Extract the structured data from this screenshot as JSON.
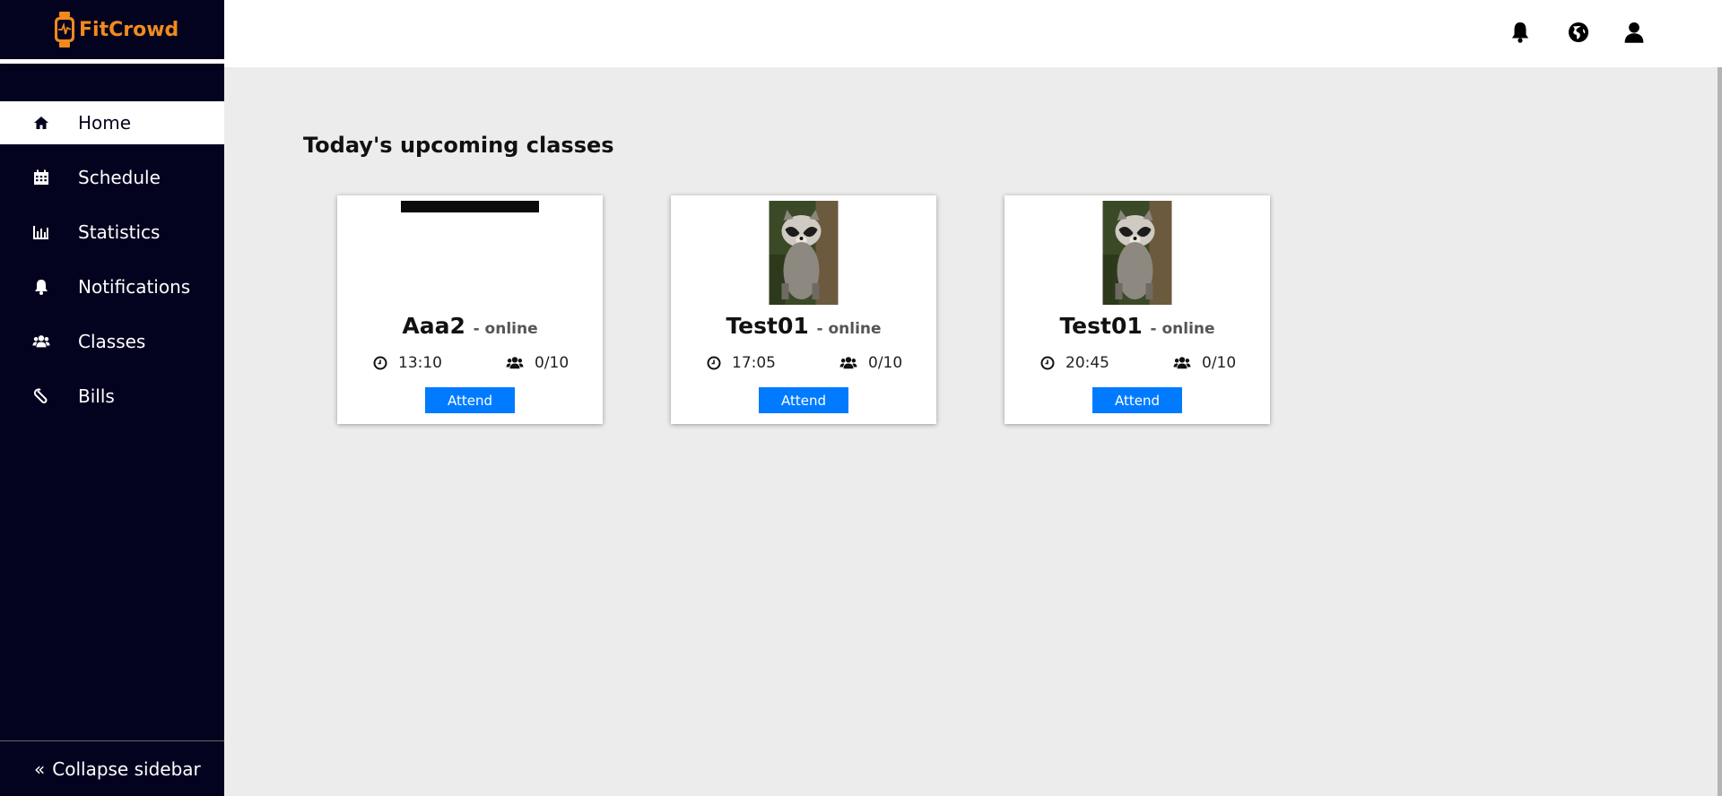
{
  "app": {
    "brand": "FitCrowd"
  },
  "sidebar": {
    "items": [
      {
        "label": "Home",
        "icon": "home-icon",
        "active": true
      },
      {
        "label": "Schedule",
        "icon": "calendar-icon"
      },
      {
        "label": "Statistics",
        "icon": "bar-chart-icon"
      },
      {
        "label": "Notifications",
        "icon": "bell-icon"
      },
      {
        "label": "Classes",
        "icon": "users-icon"
      },
      {
        "label": "Bills",
        "icon": "paperclip-icon"
      }
    ],
    "collapse_label": "Collapse sidebar"
  },
  "topbar": {
    "icons": [
      "bell-icon",
      "globe-icon",
      "user-icon"
    ]
  },
  "main": {
    "heading": "Today's upcoming classes",
    "classes": [
      {
        "name": "Aaa2",
        "mode": "- online",
        "time": "13:10",
        "capacity": "0/10",
        "button": "Attend",
        "image": "dark-banner"
      },
      {
        "name": "Test01",
        "mode": "- online",
        "time": "17:05",
        "capacity": "0/10",
        "button": "Attend",
        "image": "raccoon"
      },
      {
        "name": "Test01",
        "mode": "- online",
        "time": "20:45",
        "capacity": "0/10",
        "button": "Attend",
        "image": "raccoon"
      }
    ]
  },
  "colors": {
    "sidebar_bg": "#03031f",
    "brand": "#f08a1e",
    "button": "#007bff",
    "content_bg": "#ececec"
  }
}
